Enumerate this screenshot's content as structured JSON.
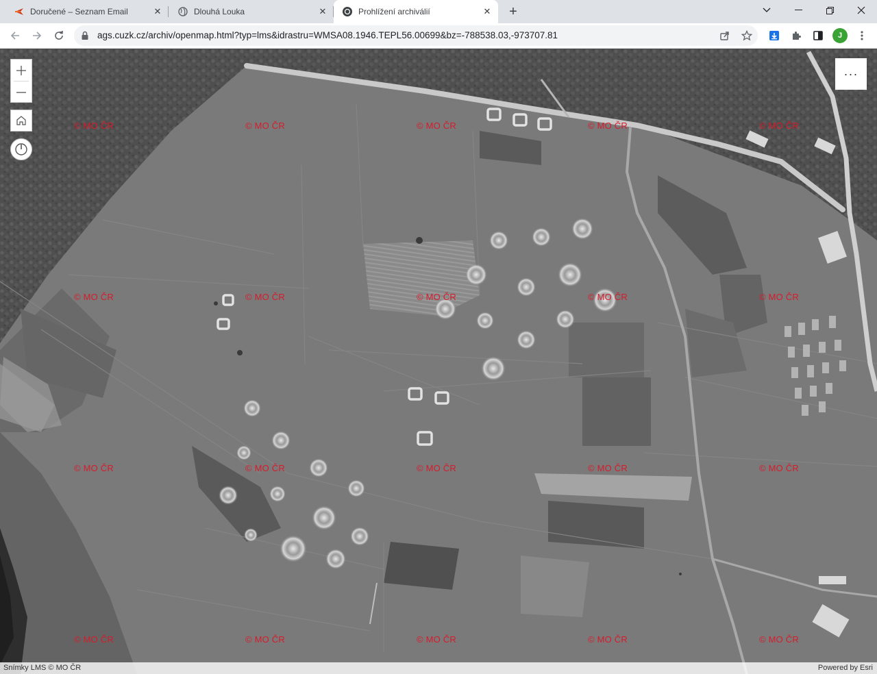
{
  "browser": {
    "tabs": [
      {
        "title": "Doručené – Seznam Email",
        "icon": "seznam-icon",
        "active": false
      },
      {
        "title": "Dlouhá Louka",
        "icon": "globe-icon",
        "active": false
      },
      {
        "title": "Prohlížení archiválií",
        "icon": "cuzk-icon",
        "active": true
      }
    ],
    "new_tab": "+",
    "address": "ags.cuzk.cz/archiv/openmap.html?typ=lms&idrastru=WMSA08.1946.TEPL56.00699&bz=-788538.03,-973707.81",
    "profile_initial": "J"
  },
  "map": {
    "watermark_text": "© MO ČR",
    "menu_label": "···",
    "attribution_left": "Snímky LMS © MO ČR",
    "attribution_right": "Powered by Esri"
  }
}
